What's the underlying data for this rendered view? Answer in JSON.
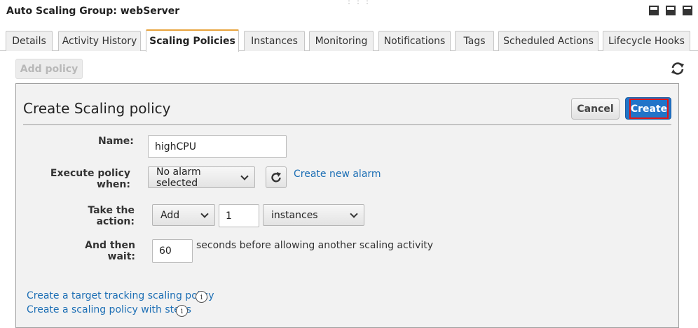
{
  "window": {
    "title": "Auto Scaling Group: webServer",
    "drag_handle": "⋮⋮⋮"
  },
  "tabs": [
    {
      "label": "Details"
    },
    {
      "label": "Activity History"
    },
    {
      "label": "Scaling Policies",
      "active": true
    },
    {
      "label": "Instances"
    },
    {
      "label": "Monitoring"
    },
    {
      "label": "Notifications"
    },
    {
      "label": "Tags"
    },
    {
      "label": "Scheduled Actions"
    },
    {
      "label": "Lifecycle Hooks"
    }
  ],
  "toolbar": {
    "add_policy_label": "Add policy"
  },
  "form": {
    "title": "Create Scaling policy",
    "cancel_label": "Cancel",
    "create_label": "Create",
    "name_label": "Name:",
    "name_value": "highCPU",
    "execute_label": "Execute policy when:",
    "alarm_select": "No alarm selected",
    "create_alarm_link": "Create new alarm",
    "action_label": "Take the action:",
    "action_select": "Add",
    "action_count": "1",
    "action_unit_select": "instances",
    "wait_label": "And then wait:",
    "wait_value": "60",
    "wait_suffix": "seconds before allowing another scaling activity",
    "target_tracking_link": "Create a target tracking scaling policy",
    "steps_link": "Create a scaling policy with steps"
  },
  "colors": {
    "active_tab_accent": "#e8a33d",
    "primary_button": "#2174c8",
    "focus_outline": "#e01515",
    "link": "#1d6fb5"
  }
}
